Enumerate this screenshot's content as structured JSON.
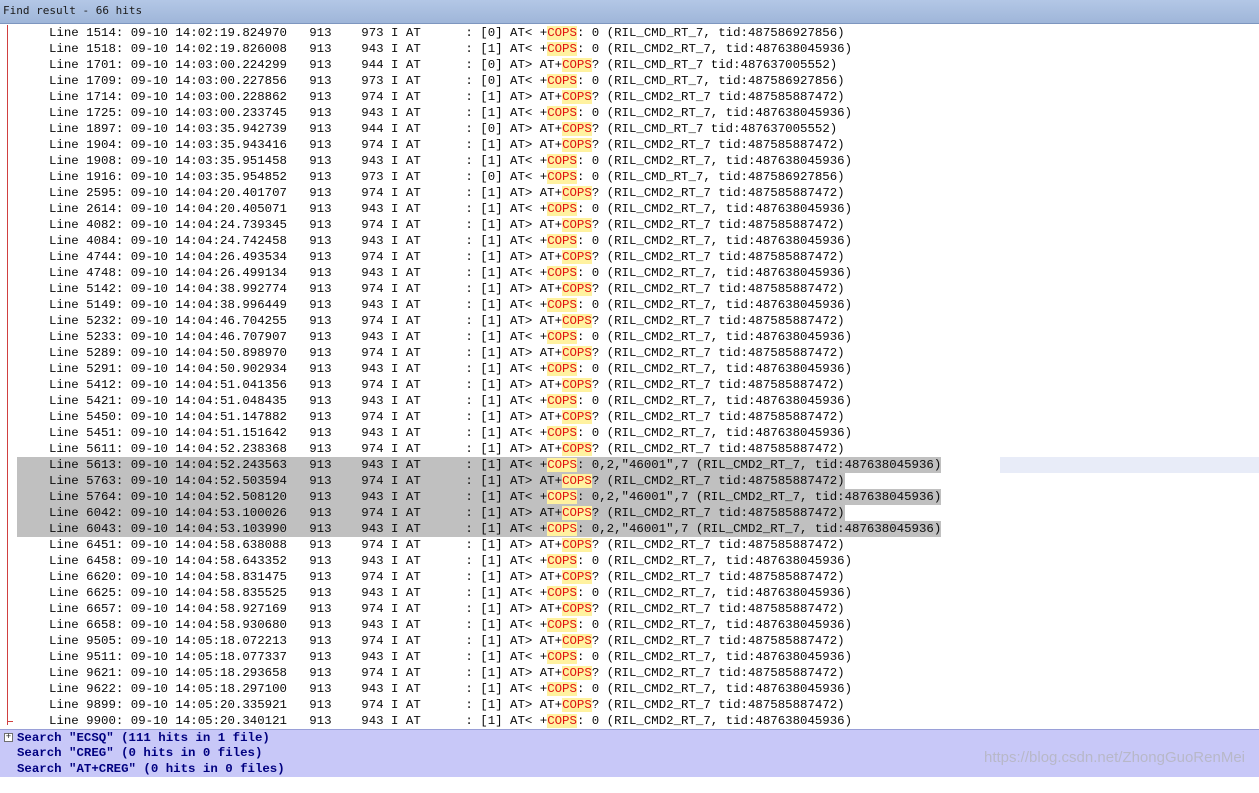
{
  "window": {
    "title": "Find result - 66 hits"
  },
  "results": [
    {
      "line": "Line 1514:",
      "time": "09-10 14:02:19.824970",
      "pid": "913",
      "tid": "973",
      "lvl": "I",
      "tag": "AT",
      "ch": "[0]",
      "dir": "AT<",
      "pre": "+",
      "kw": "COPS",
      "post": ": 0 (RIL_CMD_RT_7, tid:487586927856)",
      "sel": false
    },
    {
      "line": "Line 1518:",
      "time": "09-10 14:02:19.826008",
      "pid": "913",
      "tid": "943",
      "lvl": "I",
      "tag": "AT",
      "ch": "[1]",
      "dir": "AT<",
      "pre": "+",
      "kw": "COPS",
      "post": ": 0 (RIL_CMD2_RT_7, tid:487638045936)",
      "sel": false
    },
    {
      "line": "Line 1701:",
      "time": "09-10 14:03:00.224299",
      "pid": "913",
      "tid": "944",
      "lvl": "I",
      "tag": "AT",
      "ch": "[0]",
      "dir": "AT>",
      "pre": "AT+",
      "kw": "COPS",
      "post": "? (RIL_CMD_RT_7 tid:487637005552)",
      "sel": false
    },
    {
      "line": "Line 1709:",
      "time": "09-10 14:03:00.227856",
      "pid": "913",
      "tid": "973",
      "lvl": "I",
      "tag": "AT",
      "ch": "[0]",
      "dir": "AT<",
      "pre": "+",
      "kw": "COPS",
      "post": ": 0 (RIL_CMD_RT_7, tid:487586927856)",
      "sel": false
    },
    {
      "line": "Line 1714:",
      "time": "09-10 14:03:00.228862",
      "pid": "913",
      "tid": "974",
      "lvl": "I",
      "tag": "AT",
      "ch": "[1]",
      "dir": "AT>",
      "pre": "AT+",
      "kw": "COPS",
      "post": "? (RIL_CMD2_RT_7 tid:487585887472)",
      "sel": false
    },
    {
      "line": "Line 1725:",
      "time": "09-10 14:03:00.233745",
      "pid": "913",
      "tid": "943",
      "lvl": "I",
      "tag": "AT",
      "ch": "[1]",
      "dir": "AT<",
      "pre": "+",
      "kw": "COPS",
      "post": ": 0 (RIL_CMD2_RT_7, tid:487638045936)",
      "sel": false
    },
    {
      "line": "Line 1897:",
      "time": "09-10 14:03:35.942739",
      "pid": "913",
      "tid": "944",
      "lvl": "I",
      "tag": "AT",
      "ch": "[0]",
      "dir": "AT>",
      "pre": "AT+",
      "kw": "COPS",
      "post": "? (RIL_CMD_RT_7 tid:487637005552)",
      "sel": false
    },
    {
      "line": "Line 1904:",
      "time": "09-10 14:03:35.943416",
      "pid": "913",
      "tid": "974",
      "lvl": "I",
      "tag": "AT",
      "ch": "[1]",
      "dir": "AT>",
      "pre": "AT+",
      "kw": "COPS",
      "post": "? (RIL_CMD2_RT_7 tid:487585887472)",
      "sel": false
    },
    {
      "line": "Line 1908:",
      "time": "09-10 14:03:35.951458",
      "pid": "913",
      "tid": "943",
      "lvl": "I",
      "tag": "AT",
      "ch": "[1]",
      "dir": "AT<",
      "pre": "+",
      "kw": "COPS",
      "post": ": 0 (RIL_CMD2_RT_7, tid:487638045936)",
      "sel": false
    },
    {
      "line": "Line 1916:",
      "time": "09-10 14:03:35.954852",
      "pid": "913",
      "tid": "973",
      "lvl": "I",
      "tag": "AT",
      "ch": "[0]",
      "dir": "AT<",
      "pre": "+",
      "kw": "COPS",
      "post": ": 0 (RIL_CMD_RT_7, tid:487586927856)",
      "sel": false
    },
    {
      "line": "Line 2595:",
      "time": "09-10 14:04:20.401707",
      "pid": "913",
      "tid": "974",
      "lvl": "I",
      "tag": "AT",
      "ch": "[1]",
      "dir": "AT>",
      "pre": "AT+",
      "kw": "COPS",
      "post": "? (RIL_CMD2_RT_7 tid:487585887472)",
      "sel": false
    },
    {
      "line": "Line 2614:",
      "time": "09-10 14:04:20.405071",
      "pid": "913",
      "tid": "943",
      "lvl": "I",
      "tag": "AT",
      "ch": "[1]",
      "dir": "AT<",
      "pre": "+",
      "kw": "COPS",
      "post": ": 0 (RIL_CMD2_RT_7, tid:487638045936)",
      "sel": false
    },
    {
      "line": "Line 4082:",
      "time": "09-10 14:04:24.739345",
      "pid": "913",
      "tid": "974",
      "lvl": "I",
      "tag": "AT",
      "ch": "[1]",
      "dir": "AT>",
      "pre": "AT+",
      "kw": "COPS",
      "post": "? (RIL_CMD2_RT_7 tid:487585887472)",
      "sel": false
    },
    {
      "line": "Line 4084:",
      "time": "09-10 14:04:24.742458",
      "pid": "913",
      "tid": "943",
      "lvl": "I",
      "tag": "AT",
      "ch": "[1]",
      "dir": "AT<",
      "pre": "+",
      "kw": "COPS",
      "post": ": 0 (RIL_CMD2_RT_7, tid:487638045936)",
      "sel": false
    },
    {
      "line": "Line 4744:",
      "time": "09-10 14:04:26.493534",
      "pid": "913",
      "tid": "974",
      "lvl": "I",
      "tag": "AT",
      "ch": "[1]",
      "dir": "AT>",
      "pre": "AT+",
      "kw": "COPS",
      "post": "? (RIL_CMD2_RT_7 tid:487585887472)",
      "sel": false
    },
    {
      "line": "Line 4748:",
      "time": "09-10 14:04:26.499134",
      "pid": "913",
      "tid": "943",
      "lvl": "I",
      "tag": "AT",
      "ch": "[1]",
      "dir": "AT<",
      "pre": "+",
      "kw": "COPS",
      "post": ": 0 (RIL_CMD2_RT_7, tid:487638045936)",
      "sel": false
    },
    {
      "line": "Line 5142:",
      "time": "09-10 14:04:38.992774",
      "pid": "913",
      "tid": "974",
      "lvl": "I",
      "tag": "AT",
      "ch": "[1]",
      "dir": "AT>",
      "pre": "AT+",
      "kw": "COPS",
      "post": "? (RIL_CMD2_RT_7 tid:487585887472)",
      "sel": false
    },
    {
      "line": "Line 5149:",
      "time": "09-10 14:04:38.996449",
      "pid": "913",
      "tid": "943",
      "lvl": "I",
      "tag": "AT",
      "ch": "[1]",
      "dir": "AT<",
      "pre": "+",
      "kw": "COPS",
      "post": ": 0 (RIL_CMD2_RT_7, tid:487638045936)",
      "sel": false
    },
    {
      "line": "Line 5232:",
      "time": "09-10 14:04:46.704255",
      "pid": "913",
      "tid": "974",
      "lvl": "I",
      "tag": "AT",
      "ch": "[1]",
      "dir": "AT>",
      "pre": "AT+",
      "kw": "COPS",
      "post": "? (RIL_CMD2_RT_7 tid:487585887472)",
      "sel": false
    },
    {
      "line": "Line 5233:",
      "time": "09-10 14:04:46.707907",
      "pid": "913",
      "tid": "943",
      "lvl": "I",
      "tag": "AT",
      "ch": "[1]",
      "dir": "AT<",
      "pre": "+",
      "kw": "COPS",
      "post": ": 0 (RIL_CMD2_RT_7, tid:487638045936)",
      "sel": false
    },
    {
      "line": "Line 5289:",
      "time": "09-10 14:04:50.898970",
      "pid": "913",
      "tid": "974",
      "lvl": "I",
      "tag": "AT",
      "ch": "[1]",
      "dir": "AT>",
      "pre": "AT+",
      "kw": "COPS",
      "post": "? (RIL_CMD2_RT_7 tid:487585887472)",
      "sel": false
    },
    {
      "line": "Line 5291:",
      "time": "09-10 14:04:50.902934",
      "pid": "913",
      "tid": "943",
      "lvl": "I",
      "tag": "AT",
      "ch": "[1]",
      "dir": "AT<",
      "pre": "+",
      "kw": "COPS",
      "post": ": 0 (RIL_CMD2_RT_7, tid:487638045936)",
      "sel": false
    },
    {
      "line": "Line 5412:",
      "time": "09-10 14:04:51.041356",
      "pid": "913",
      "tid": "974",
      "lvl": "I",
      "tag": "AT",
      "ch": "[1]",
      "dir": "AT>",
      "pre": "AT+",
      "kw": "COPS",
      "post": "? (RIL_CMD2_RT_7 tid:487585887472)",
      "sel": false
    },
    {
      "line": "Line 5421:",
      "time": "09-10 14:04:51.048435",
      "pid": "913",
      "tid": "943",
      "lvl": "I",
      "tag": "AT",
      "ch": "[1]",
      "dir": "AT<",
      "pre": "+",
      "kw": "COPS",
      "post": ": 0 (RIL_CMD2_RT_7, tid:487638045936)",
      "sel": false
    },
    {
      "line": "Line 5450:",
      "time": "09-10 14:04:51.147882",
      "pid": "913",
      "tid": "974",
      "lvl": "I",
      "tag": "AT",
      "ch": "[1]",
      "dir": "AT>",
      "pre": "AT+",
      "kw": "COPS",
      "post": "? (RIL_CMD2_RT_7 tid:487585887472)",
      "sel": false
    },
    {
      "line": "Line 5451:",
      "time": "09-10 14:04:51.151642",
      "pid": "913",
      "tid": "943",
      "lvl": "I",
      "tag": "AT",
      "ch": "[1]",
      "dir": "AT<",
      "pre": "+",
      "kw": "COPS",
      "post": ": 0 (RIL_CMD2_RT_7, tid:487638045936)",
      "sel": false
    },
    {
      "line": "Line 5611:",
      "time": "09-10 14:04:52.238368",
      "pid": "913",
      "tid": "974",
      "lvl": "I",
      "tag": "AT",
      "ch": "[1]",
      "dir": "AT>",
      "pre": "AT+",
      "kw": "COPS",
      "post": "? (RIL_CMD2_RT_7 tid:487585887472)",
      "sel": false
    },
    {
      "line": "Line 5613:",
      "time": "09-10 14:04:52.243563",
      "pid": "913",
      "tid": "943",
      "lvl": "I",
      "tag": "AT",
      "ch": "[1]",
      "dir": "AT<",
      "pre": "+",
      "kw": "COPS",
      "post": ": 0,2,\"46001\",7 (RIL_CMD2_RT_7, tid:487638045936)",
      "sel": true
    },
    {
      "line": "Line 5763:",
      "time": "09-10 14:04:52.503594",
      "pid": "913",
      "tid": "974",
      "lvl": "I",
      "tag": "AT",
      "ch": "[1]",
      "dir": "AT>",
      "pre": "AT+",
      "kw": "COPS",
      "post": "? (RIL_CMD2_RT_7 tid:487585887472)",
      "sel": true
    },
    {
      "line": "Line 5764:",
      "time": "09-10 14:04:52.508120",
      "pid": "913",
      "tid": "943",
      "lvl": "I",
      "tag": "AT",
      "ch": "[1]",
      "dir": "AT<",
      "pre": "+",
      "kw": "COPS",
      "post": ": 0,2,\"46001\",7 (RIL_CMD2_RT_7, tid:487638045936)",
      "sel": true
    },
    {
      "line": "Line 6042:",
      "time": "09-10 14:04:53.100026",
      "pid": "913",
      "tid": "974",
      "lvl": "I",
      "tag": "AT",
      "ch": "[1]",
      "dir": "AT>",
      "pre": "AT+",
      "kw": "COPS",
      "post": "? (RIL_CMD2_RT_7 tid:487585887472)",
      "sel": true
    },
    {
      "line": "Line 6043:",
      "time": "09-10 14:04:53.103990",
      "pid": "913",
      "tid": "943",
      "lvl": "I",
      "tag": "AT",
      "ch": "[1]",
      "dir": "AT<",
      "pre": "+",
      "kw": "COPS",
      "post": ": 0,2,\"46001\",7 (RIL_CMD2_RT_7, tid:487638045936)",
      "sel": true
    },
    {
      "line": "Line 6451:",
      "time": "09-10 14:04:58.638088",
      "pid": "913",
      "tid": "974",
      "lvl": "I",
      "tag": "AT",
      "ch": "[1]",
      "dir": "AT>",
      "pre": "AT+",
      "kw": "COPS",
      "post": "? (RIL_CMD2_RT_7 tid:487585887472)",
      "sel": false
    },
    {
      "line": "Line 6458:",
      "time": "09-10 14:04:58.643352",
      "pid": "913",
      "tid": "943",
      "lvl": "I",
      "tag": "AT",
      "ch": "[1]",
      "dir": "AT<",
      "pre": "+",
      "kw": "COPS",
      "post": ": 0 (RIL_CMD2_RT_7, tid:487638045936)",
      "sel": false
    },
    {
      "line": "Line 6620:",
      "time": "09-10 14:04:58.831475",
      "pid": "913",
      "tid": "974",
      "lvl": "I",
      "tag": "AT",
      "ch": "[1]",
      "dir": "AT>",
      "pre": "AT+",
      "kw": "COPS",
      "post": "? (RIL_CMD2_RT_7 tid:487585887472)",
      "sel": false
    },
    {
      "line": "Line 6625:",
      "time": "09-10 14:04:58.835525",
      "pid": "913",
      "tid": "943",
      "lvl": "I",
      "tag": "AT",
      "ch": "[1]",
      "dir": "AT<",
      "pre": "+",
      "kw": "COPS",
      "post": ": 0 (RIL_CMD2_RT_7, tid:487638045936)",
      "sel": false
    },
    {
      "line": "Line 6657:",
      "time": "09-10 14:04:58.927169",
      "pid": "913",
      "tid": "974",
      "lvl": "I",
      "tag": "AT",
      "ch": "[1]",
      "dir": "AT>",
      "pre": "AT+",
      "kw": "COPS",
      "post": "? (RIL_CMD2_RT_7 tid:487585887472)",
      "sel": false
    },
    {
      "line": "Line 6658:",
      "time": "09-10 14:04:58.930680",
      "pid": "913",
      "tid": "943",
      "lvl": "I",
      "tag": "AT",
      "ch": "[1]",
      "dir": "AT<",
      "pre": "+",
      "kw": "COPS",
      "post": ": 0 (RIL_CMD2_RT_7, tid:487638045936)",
      "sel": false
    },
    {
      "line": "Line 9505:",
      "time": "09-10 14:05:18.072213",
      "pid": "913",
      "tid": "974",
      "lvl": "I",
      "tag": "AT",
      "ch": "[1]",
      "dir": "AT>",
      "pre": "AT+",
      "kw": "COPS",
      "post": "? (RIL_CMD2_RT_7 tid:487585887472)",
      "sel": false
    },
    {
      "line": "Line 9511:",
      "time": "09-10 14:05:18.077337",
      "pid": "913",
      "tid": "943",
      "lvl": "I",
      "tag": "AT",
      "ch": "[1]",
      "dir": "AT<",
      "pre": "+",
      "kw": "COPS",
      "post": ": 0 (RIL_CMD2_RT_7, tid:487638045936)",
      "sel": false
    },
    {
      "line": "Line 9621:",
      "time": "09-10 14:05:18.293658",
      "pid": "913",
      "tid": "974",
      "lvl": "I",
      "tag": "AT",
      "ch": "[1]",
      "dir": "AT>",
      "pre": "AT+",
      "kw": "COPS",
      "post": "? (RIL_CMD2_RT_7 tid:487585887472)",
      "sel": false
    },
    {
      "line": "Line 9622:",
      "time": "09-10 14:05:18.297100",
      "pid": "913",
      "tid": "943",
      "lvl": "I",
      "tag": "AT",
      "ch": "[1]",
      "dir": "AT<",
      "pre": "+",
      "kw": "COPS",
      "post": ": 0 (RIL_CMD2_RT_7, tid:487638045936)",
      "sel": false
    },
    {
      "line": "Line 9899:",
      "time": "09-10 14:05:20.335921",
      "pid": "913",
      "tid": "974",
      "lvl": "I",
      "tag": "AT",
      "ch": "[1]",
      "dir": "AT>",
      "pre": "AT+",
      "kw": "COPS",
      "post": "? (RIL_CMD2_RT_7 tid:487585887472)",
      "sel": false
    },
    {
      "line": "Line 9900:",
      "time": "09-10 14:05:20.340121",
      "pid": "913",
      "tid": "943",
      "lvl": "I",
      "tag": "AT",
      "ch": "[1]",
      "dir": "AT<",
      "pre": "+",
      "kw": "COPS",
      "post": ": 0 (RIL_CMD2_RT_7, tid:487638045936)",
      "sel": false
    }
  ],
  "searches": [
    {
      "text": "Search \"ECSQ\" (111 hits in 1 file)",
      "expander": "+"
    },
    {
      "text": "Search \"CREG\" (0 hits in 0 files)",
      "expander": ""
    },
    {
      "text": "Search \"AT+CREG\" (0 hits in 0 files)",
      "expander": ""
    }
  ],
  "watermark": "https://blog.csdn.net/ZhongGuoRenMei",
  "colors": {
    "keyword": "#e01010",
    "keyword_bg": "#fff2a0",
    "selection": "#c0c0c0",
    "footer": "#c8c8f8"
  }
}
